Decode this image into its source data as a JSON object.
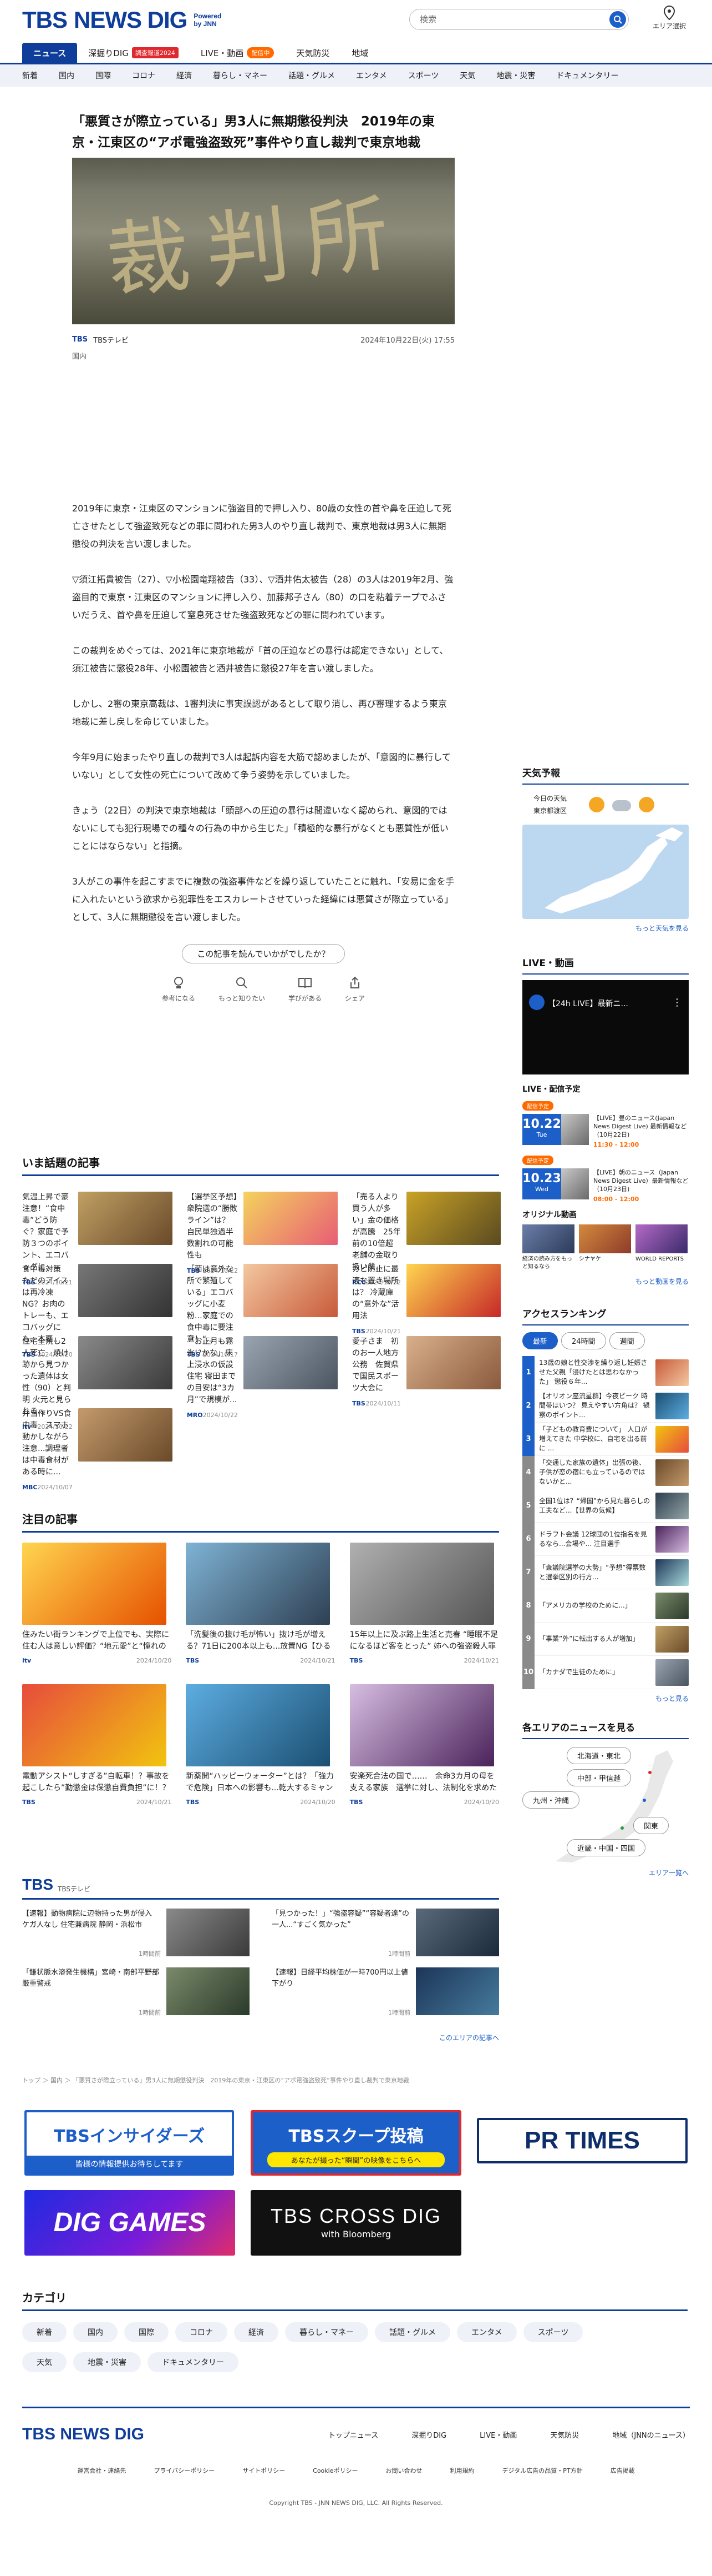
{
  "header": {
    "logo_main": "TBS",
    "logo_sub": "NEWS DIG",
    "powered": "Powered\nby JNN",
    "search_placeholder": "検索",
    "area_label": "エリア選択"
  },
  "nav1": [
    {
      "label": "ニュース",
      "active": true
    },
    {
      "label": "深掘りDIG",
      "badge": "調査報道2024"
    },
    {
      "label": "LIVE・動画",
      "badge2": "配信中"
    },
    {
      "label": "天気防災"
    },
    {
      "label": "地域"
    }
  ],
  "nav2": [
    "新着",
    "国内",
    "国際",
    "コロナ",
    "経済",
    "暮らし・マネー",
    "話題・グルメ",
    "エンタメ",
    "スポーツ",
    "天気",
    "地震・災害",
    "ドキュメンタリー"
  ],
  "article": {
    "headline": "「悪質さが際立っている」男3人に無期懲役判決　2019年の東京・江東区の“アポ電強盗致死”事件やり直し裁判で東京地裁",
    "hero_text": "裁判所",
    "source": "TBS",
    "source_name": "TBSテレビ",
    "date": "2024年10月22日(火) 17:55",
    "category": "国内",
    "paragraphs": [
      "2019年に東京・江東区のマンションに強盗目的で押し入り、80歳の女性の首や鼻を圧迫して死亡させたとして強盗致死などの罪に問われた男3人のやり直し裁判で、東京地裁は男3人に無期懲役の判決を言い渡しました。",
      "▽須江拓貴被告（27）、▽小松園竜翔被告（33）、▽酒井佑太被告（28）の3人は2019年2月、強盗目的で東京・江東区のマンションに押し入り、加藤邦子さん（80）の口を粘着テープでふさいだうえ、首や鼻を圧迫して窒息死させた強盗致死などの罪に問われています。",
      "この裁判をめぐっては、2021年に東京地裁が「首の圧迫などの暴行は認定できない」として、須江被告に懲役28年、小松園被告と酒井被告に懲役27年を言い渡しました。",
      "しかし、2審の東京高裁は、1審判決に事実誤認があるとして取り消し、再び審理するよう東京地裁に差し戻しを命じていました。",
      "今年9月に始まったやり直しの裁判で3人は起訴内容を大筋で認めましたが、「意図的に暴行していない」として女性の死亡について改めて争う姿勢を示していました。",
      "きょう（22日）の判決で東京地裁は「頭部への圧迫の暴行は間違いなく認められ、意図的ではないにしても犯行現場での種々の行為の中から生じた」「積極的な暴行がなくとも悪質性が低いことにはならない」と指摘。",
      "3人がこの事件を起こすまでに複数の強盗事件などを繰り返していたことに触れ、「安易に金を手に入れたいという欲求から犯罪性をエスカレートさせていった経緯には悪質さが際立っている」として、3人に無期懲役を言い渡しました。"
    ],
    "feedback_question": "この記事を読んでいかがでしたか？",
    "reactions": [
      "参考になる",
      "もっと知りたい",
      "学びがある",
      "シェア"
    ]
  },
  "trending": {
    "title": "いま話題の記事",
    "items": [
      {
        "title": "気温上昇で豪注意！“食中毒”どう防ぐ？家庭で予防３つのポイント、エコバッグに…",
        "src": "TBS",
        "date": "2024/10/21"
      },
      {
        "title": "【選挙区予想】衆院選の“勝敗ライン”は？ 自民単独過半数割れの可能性も",
        "src": "TBS",
        "date": "2024/10/22"
      },
      {
        "title": "「売る人より買う人が多い」金の価格が高騰　25年前の10倍超　老舗の金取り扱い業...",
        "src": "RCC",
        "date": "2024/10/22"
      },
      {
        "title": "食中毒対策　ただのアイスは再冷凍NG？お肉のトレーも、エコバッグにも、本要...",
        "src": "TBS",
        "date": "2024/10/20"
      },
      {
        "title": "「菌は意外な所で繁殖している」エコバッグに小麦粉…家庭での食中毒に要注意！“...",
        "src": "TBS",
        "date": "2024/10/17"
      },
      {
        "title": "カビ防止に最適な置き場所は？ 冷蔵庫の“意外な”活用法",
        "src": "TBS",
        "date": "2024/10/21"
      },
      {
        "title": "住宅全焼し2人死亡　焼け跡から見つかった遺体は女性（90）と判明 火元と見られる...",
        "src": "itv",
        "date": "2024/10/22"
      },
      {
        "title": "「お正月も霧氷!?かな」床上浸水の仮設住宅 寝田までの目安は“3カ月”で規模が...",
        "src": "MRO",
        "date": "2024/10/22"
      },
      {
        "title": "愛子さま　初のお一人地方公務　佐賀県で国民スポーツ大会に",
        "src": "TBS",
        "date": "2024/10/11"
      },
      {
        "title": "弁当作りVS食中毒　スマホ動かしながら注意...調理者は中毒食材がある時に...",
        "src": "MBC",
        "date": "2024/10/07"
      }
    ]
  },
  "featured": {
    "title": "注目の記事",
    "items": [
      {
        "title": "住みたい街ランキングで上位でも、実際に住む人は意しい評価？“地元愛”と“憧れの地”の温度差【都道...",
        "src": "itv",
        "date": "2024/10/20"
      },
      {
        "title": "「洗髪後の抜け毛が怖い」抜け毛が増える？71日に200本以上も...放置NG【ひるおび】",
        "src": "TBS",
        "date": "2024/10/21"
      },
      {
        "title": "15年以上に及ぶ路上生活と売春 “睡眠不足になるほど客をとった” 姉への強盗殺人罪に問われた...",
        "src": "TBS",
        "date": "2024/10/21"
      },
      {
        "title": "電動アシスト“しすぎる”自転車！？事故を起こしたら”勤懲金は保懲自費負担”に！？ルール違反で「...",
        "src": "TBS",
        "date": "2024/10/21"
      },
      {
        "title": "新薬開“ハッピーウォーター”とは？「強力で危険」日本への影響も...乾大するミャンマー麻薬ビジネスの闇",
        "src": "TBS",
        "date": "2024/10/20"
      },
      {
        "title": "安楽死合法の国で……　余命3カ月の母を支える家族　選挙に対し、法制化を求めた男性",
        "src": "TBS",
        "date": "2024/10/20"
      }
    ]
  },
  "tbs_section": {
    "title": "TBS",
    "sub": "TBSテレビ",
    "items": [
      {
        "title": "【速報】動物病院に辺物持った男が侵入 ケガ人なし 住宅兼病院 静岡・浜松市",
        "time": "1時間前"
      },
      {
        "title": "「見つかった！」“強盗容疑”“容疑者達”の一人...“すごく気かった”",
        "time": "1時間前"
      },
      {
        "title": "「鎌状脈水溶発生機構」宮崎・南部平野部　厳重警戒",
        "time": "1時間前"
      },
      {
        "title": "【速報】日経平均株価が一時700円以上値下がり",
        "time": "1時間前"
      }
    ],
    "more": "このエリアの記事へ"
  },
  "breadcrumb": "トップ ＞ 国内 ＞ 「悪質さが際立っている」男3人に無期懲役判決　2019年の東京・江東区の“アポ電強盗致死”事件やり直し裁判で東京地裁",
  "banners": [
    {
      "label": "TBSインサイダーズ",
      "sub": "皆様の情報提供お待ちしてます"
    },
    {
      "label": "TBSスクープ投稿",
      "sub": "あなたが撮った“瞬間”の映像をこちらへ"
    },
    {
      "label": "PR TIMES"
    },
    {
      "label": "DIG GAMES"
    },
    {
      "label": "TBS CROSS DIG",
      "sub": "with Bloomberg"
    }
  ],
  "categories": {
    "title": "カテゴリ",
    "items": [
      "新着",
      "国内",
      "国際",
      "コロナ",
      "経済",
      "暮らし・マネー",
      "話題・グルメ",
      "エンタメ",
      "スポーツ",
      "天気",
      "地震・災害",
      "ドキュメンタリー"
    ]
  },
  "sidebar": {
    "weather": {
      "title": "天気予報",
      "today": "今日の天気",
      "area": "東京都渡区",
      "more": "もっと天気を見る"
    },
    "live": {
      "title": "LIVE・動画",
      "video_title": "【24h LIVE】最新ニ...",
      "schedule_title": "LIVE・配信予定",
      "sched": [
        {
          "date": "10.22",
          "day": "Tue",
          "title": "【LIVE】昼のニュース(Japan News Digest Live) 最新情報など（10月22日)",
          "time": "11:30 - 12:00",
          "badge": "配信予定"
        },
        {
          "date": "10.23",
          "day": "Wed",
          "title": "【LIVE】朝のニュース（Japan News Digest Live）最新情報など（10月23日)",
          "time": "08:00 - 12:00",
          "badge": "配信予定"
        }
      ],
      "original_title": "オリジナル動画",
      "originals": [
        "経済の読み方をもっと知るなら",
        "シナヤケ",
        "WORLD REPORTS"
      ],
      "more": "もっと動画を見る"
    },
    "ranking": {
      "title": "アクセスランキング",
      "tabs": [
        "最新",
        "24時間",
        "週間"
      ],
      "items": [
        "13歳の娘と性交渉を繰り返し妊娠させた父親「浸けたとは思わなかった」 懲役６年...",
        "【オリオン座流星群】今夜ピーク 時間帯はいつ？ 見えやすい方角は？ 観察のポイント...",
        "「子どもの教育費について」 人口が増えてきた 中学校に、自宅を出る前に ...",
        "「交通した家族の遺体」出張の後、子供が恋の宿にも立っているのではないかと...",
        "全国1位は？“帰国”から見た暮らしの工夫など...【世界の気候】",
        "ドラフト会議 12球団の1位指名を見るなら...会場や... 注目選手",
        "「衆議院選挙の大勢」“予想”得票数と選挙区別の行方...",
        "「アメリカの学校のために...」",
        "「事業”外”に転出する人が増加」",
        "「カナダで生徒のために」"
      ],
      "more": "もっと見る"
    },
    "area": {
      "title": "各エリアのニュースを見る",
      "regions": [
        "北海道・東北",
        "中部・甲信越",
        "九州・沖縄",
        "関東",
        "近畿・中国・四国"
      ],
      "more": "エリア一覧へ"
    }
  },
  "footer": {
    "links1": [
      "トップニュース",
      "深掘りDIG",
      "LIVE・動画",
      "天気防災",
      "地域（JNNのニュース）"
    ],
    "links2": [
      "運営会社・連絡先",
      "プライバシーポリシー",
      "サイトポリシー",
      "Cookieポリシー",
      "お問い合わせ",
      "利用規約",
      "デジタル広告の品質・PT方針",
      "広告掲載"
    ],
    "copyright": "Copyright TBS - JNN NEWS DIG, LLC. All Rights Reserved."
  }
}
